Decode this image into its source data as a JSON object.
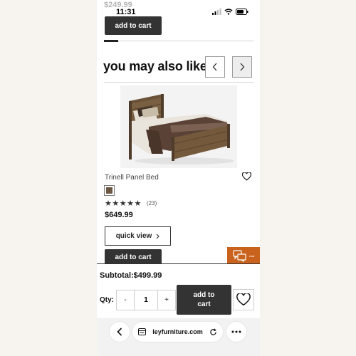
{
  "status_bar": {
    "time": "11:31"
  },
  "previous_item": {
    "price": "$249.99",
    "add_to_cart_label": "add to cart"
  },
  "recommendations": {
    "title": "you may also like",
    "product": {
      "name": "Trinell Panel Bed",
      "rating_stars": 5,
      "review_count": "(23)",
      "price": "$649.99",
      "quick_view_label": "quick view",
      "add_to_cart_label": "add to cart"
    }
  },
  "chat": {
    "label": "chat"
  },
  "cart_panel": {
    "subtotal": "Subtotal:$499.99",
    "qty_label": "Qty:",
    "qty_minus": "-",
    "qty_value": "1",
    "qty_plus": "+",
    "add_to_cart_label": "add to cart"
  },
  "browser": {
    "url": "leyfurniture.com"
  },
  "colors": {
    "button_dark": "#333333",
    "chat_orange": "#c9621c",
    "swatch": "#6b5644"
  },
  "icons": [
    "signal-icon",
    "wifi-icon",
    "battery-icon",
    "chevron-left-icon",
    "chevron-right-icon",
    "heart-icon",
    "chat-bubbles-icon",
    "tabs-icon",
    "reload-icon",
    "more-icon"
  ]
}
